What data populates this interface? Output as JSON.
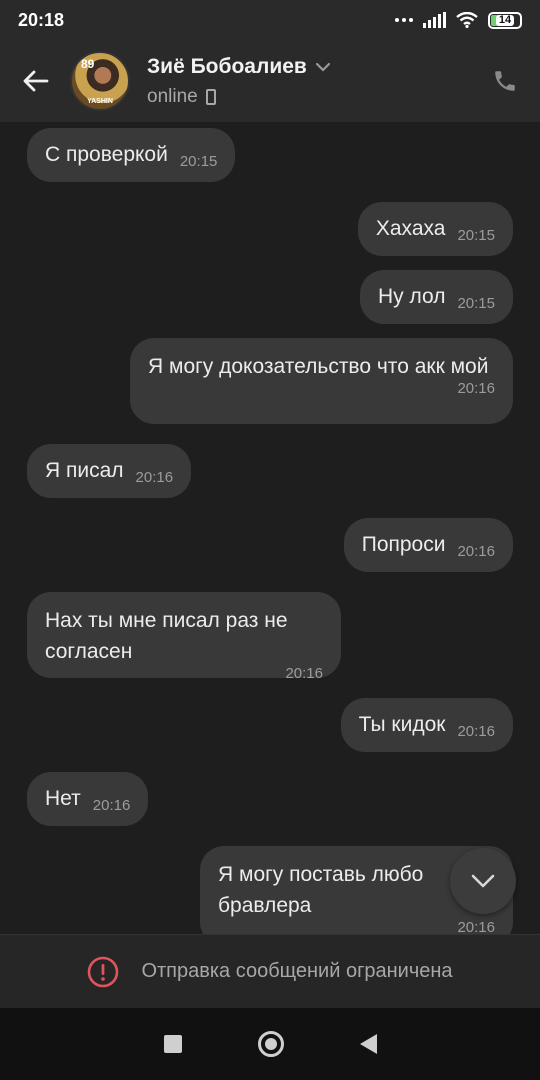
{
  "status_bar": {
    "time": "20:18",
    "battery": "14"
  },
  "header": {
    "contact_name": "Зиё Бобоалиев",
    "status": "online",
    "avatar_rating": "89",
    "avatar_card_name": "YASHIN"
  },
  "messages": [
    {
      "side": "in",
      "text": "С проверкой",
      "time": "20:15"
    },
    {
      "side": "out",
      "text": "Хахаха",
      "time": "20:15"
    },
    {
      "side": "out",
      "text": "Ну лол",
      "time": "20:15"
    },
    {
      "side": "out",
      "text": "Я могу докозательство что акк мой",
      "time": "20:16"
    },
    {
      "side": "in",
      "text": "Я писал",
      "time": "20:16"
    },
    {
      "side": "out",
      "text": "Попроси",
      "time": "20:16"
    },
    {
      "side": "in",
      "text": "Нах ты мне писал раз не согласен",
      "time": "20:16"
    },
    {
      "side": "out",
      "text": "Ты кидок",
      "time": "20:16"
    },
    {
      "side": "in",
      "text": "Нет",
      "time": "20:16"
    },
    {
      "side": "out",
      "text": "Я могу поставь любо бравлера",
      "time": "20:16"
    }
  ],
  "restriction": {
    "text": "Отправка сообщений ограничена"
  },
  "colors": {
    "bubble": "#393939",
    "background": "#1e1e1e",
    "header": "#2a2a2a",
    "alert": "#e0545d"
  },
  "icons": [
    "back-arrow-icon",
    "chevron-down-icon",
    "phone-icon",
    "chevron-down-icon",
    "alert-icon",
    "nav-recents-icon",
    "nav-home-icon",
    "nav-back-icon"
  ]
}
